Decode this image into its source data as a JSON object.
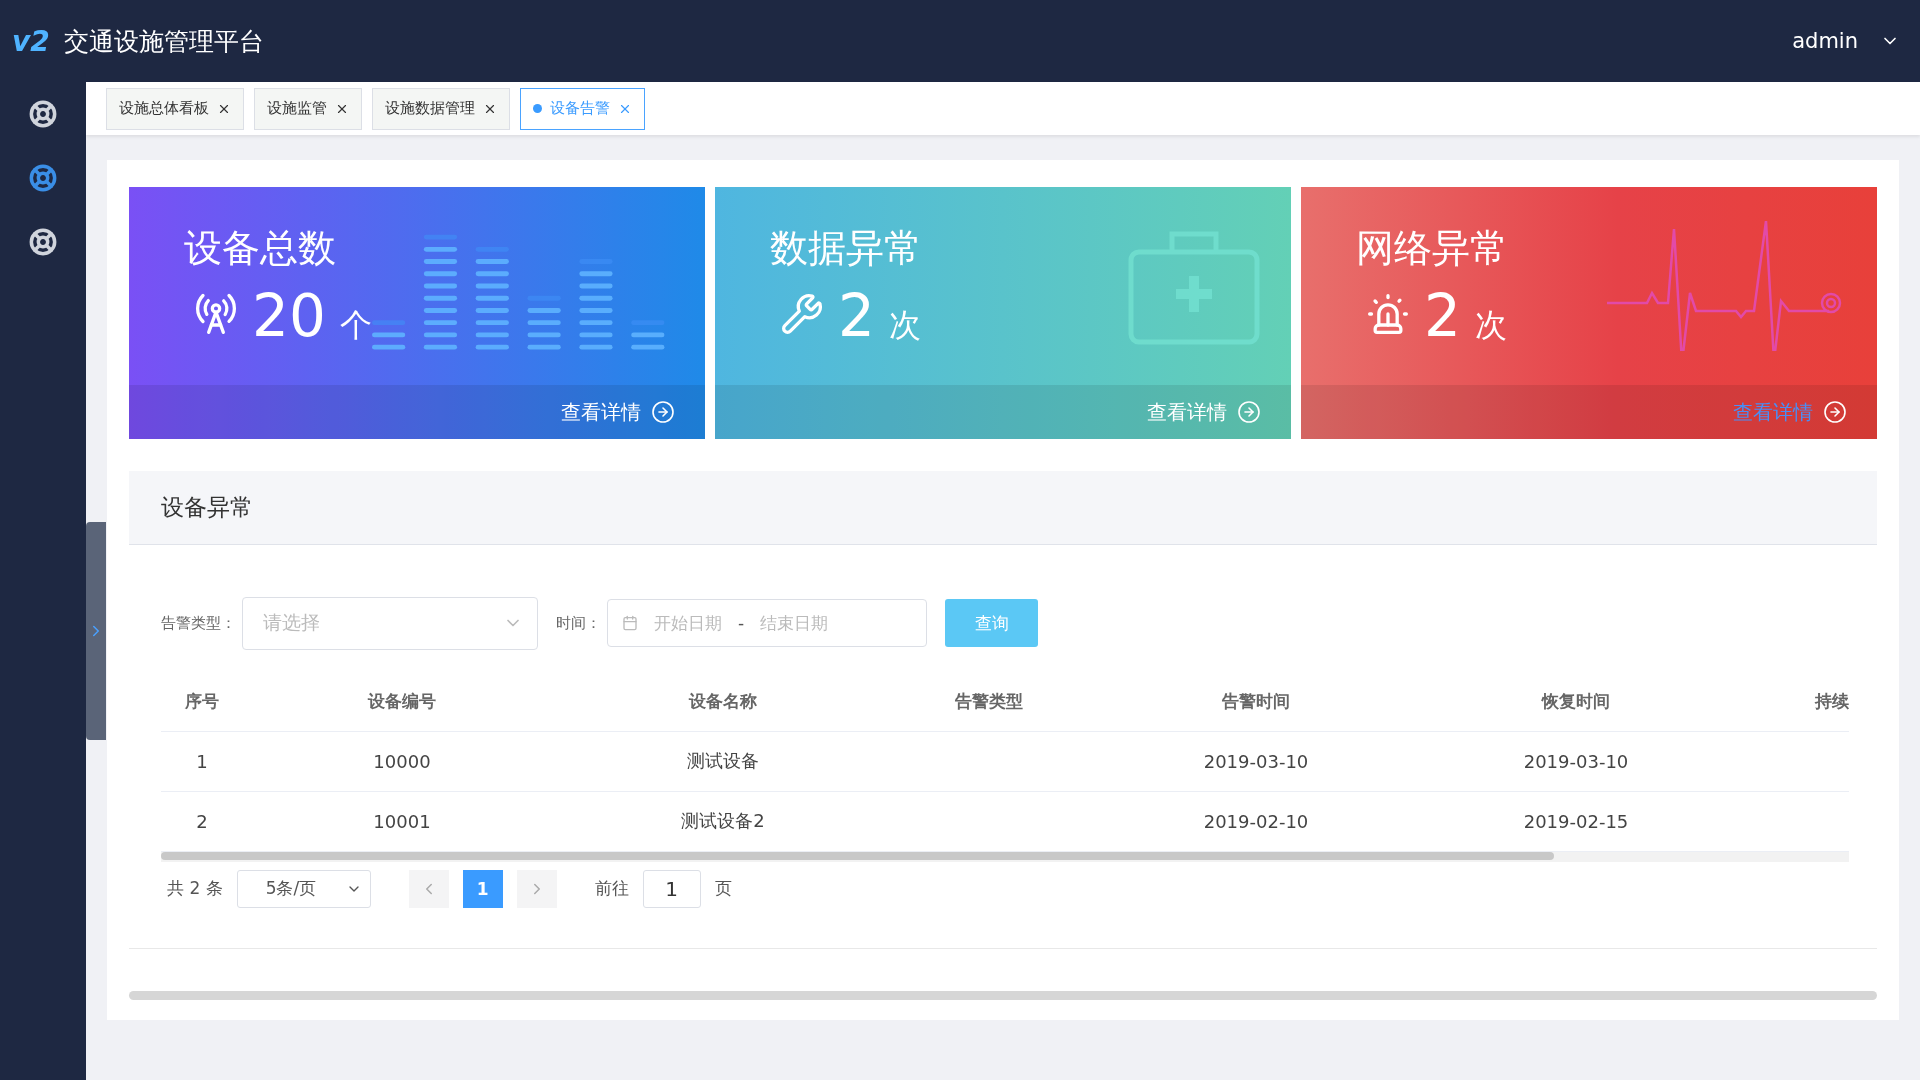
{
  "header": {
    "logo": "v2",
    "title": "交通设施管理平台",
    "user": "admin"
  },
  "sidebar": {
    "items": [
      {
        "selected": false
      },
      {
        "selected": true
      },
      {
        "selected": false
      }
    ]
  },
  "tabs": [
    {
      "label": "设施总体看板",
      "selected": false
    },
    {
      "label": "设施监管",
      "selected": false
    },
    {
      "label": "设施数据管理",
      "selected": false
    },
    {
      "label": "设备告警",
      "selected": true
    }
  ],
  "cards": [
    {
      "kind": "devices",
      "title": "设备总数",
      "value": "20",
      "unit": "个",
      "link": "查看详情",
      "link_highlighted": false
    },
    {
      "kind": "data",
      "title": "数据异常",
      "value": "2",
      "unit": "次",
      "link": "查看详情",
      "link_highlighted": false
    },
    {
      "kind": "network",
      "title": "网络异常",
      "value": "2",
      "unit": "次",
      "link": "查看详情",
      "link_highlighted": true
    }
  ],
  "section": {
    "title": "设备异常"
  },
  "filters": {
    "type_label": "告警类型：",
    "type_placeholder": "请选择",
    "time_label": "时间：",
    "start_placeholder": "开始日期",
    "separator": "-",
    "end_placeholder": "结束日期",
    "button": "查询"
  },
  "table": {
    "columns": [
      "序号",
      "设备编号",
      "设备名称",
      "告警类型",
      "告警时间",
      "恢复时间",
      "持续"
    ],
    "rows": [
      {
        "index": "1",
        "code": "10000",
        "name": "测试设备",
        "alarm_time": "2019-03-10",
        "recover_time": "2019-03-10"
      },
      {
        "index": "2",
        "code": "10001",
        "name": "测试设备2",
        "alarm_time": "2019-02-10",
        "recover_time": "2019-02-15"
      }
    ]
  },
  "pagination": {
    "total": "共 2 条",
    "page_size": "5条/页",
    "pages": [
      {
        "label": "1",
        "selected": true
      }
    ],
    "goto_label": "前往",
    "goto_value": "1",
    "goto_suffix": "页"
  }
}
